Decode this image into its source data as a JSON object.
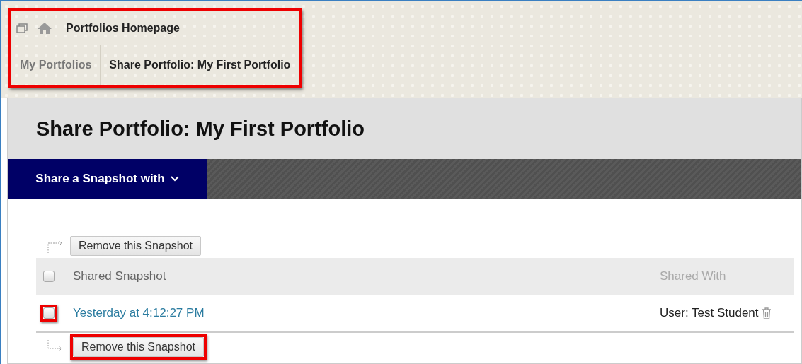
{
  "breadcrumbs": {
    "highlighted": true,
    "top": {
      "label": "Portfolios Homepage"
    },
    "trail": [
      {
        "label": "My Portfolios",
        "current": false
      },
      {
        "label": "Share Portfolio: My First Portfolio",
        "current": true
      }
    ]
  },
  "page_title": "Share Portfolio: My First Portfolio",
  "action_bar": {
    "menu_label": "Share a Snapshot with",
    "expanded": false
  },
  "top_action": {
    "label": "Remove this Snapshot",
    "highlighted": false
  },
  "table": {
    "columns": [
      {
        "label": "Shared Snapshot"
      },
      {
        "label": "Shared With"
      }
    ],
    "select_all_checked": false,
    "rows": [
      {
        "snapshot": "Yesterday at 4:12:27 PM",
        "shared_with": "User: Test Student",
        "checked": false,
        "highlighted": true
      }
    ]
  },
  "bottom_action": {
    "label": "Remove this Snapshot",
    "highlighted": true
  }
}
